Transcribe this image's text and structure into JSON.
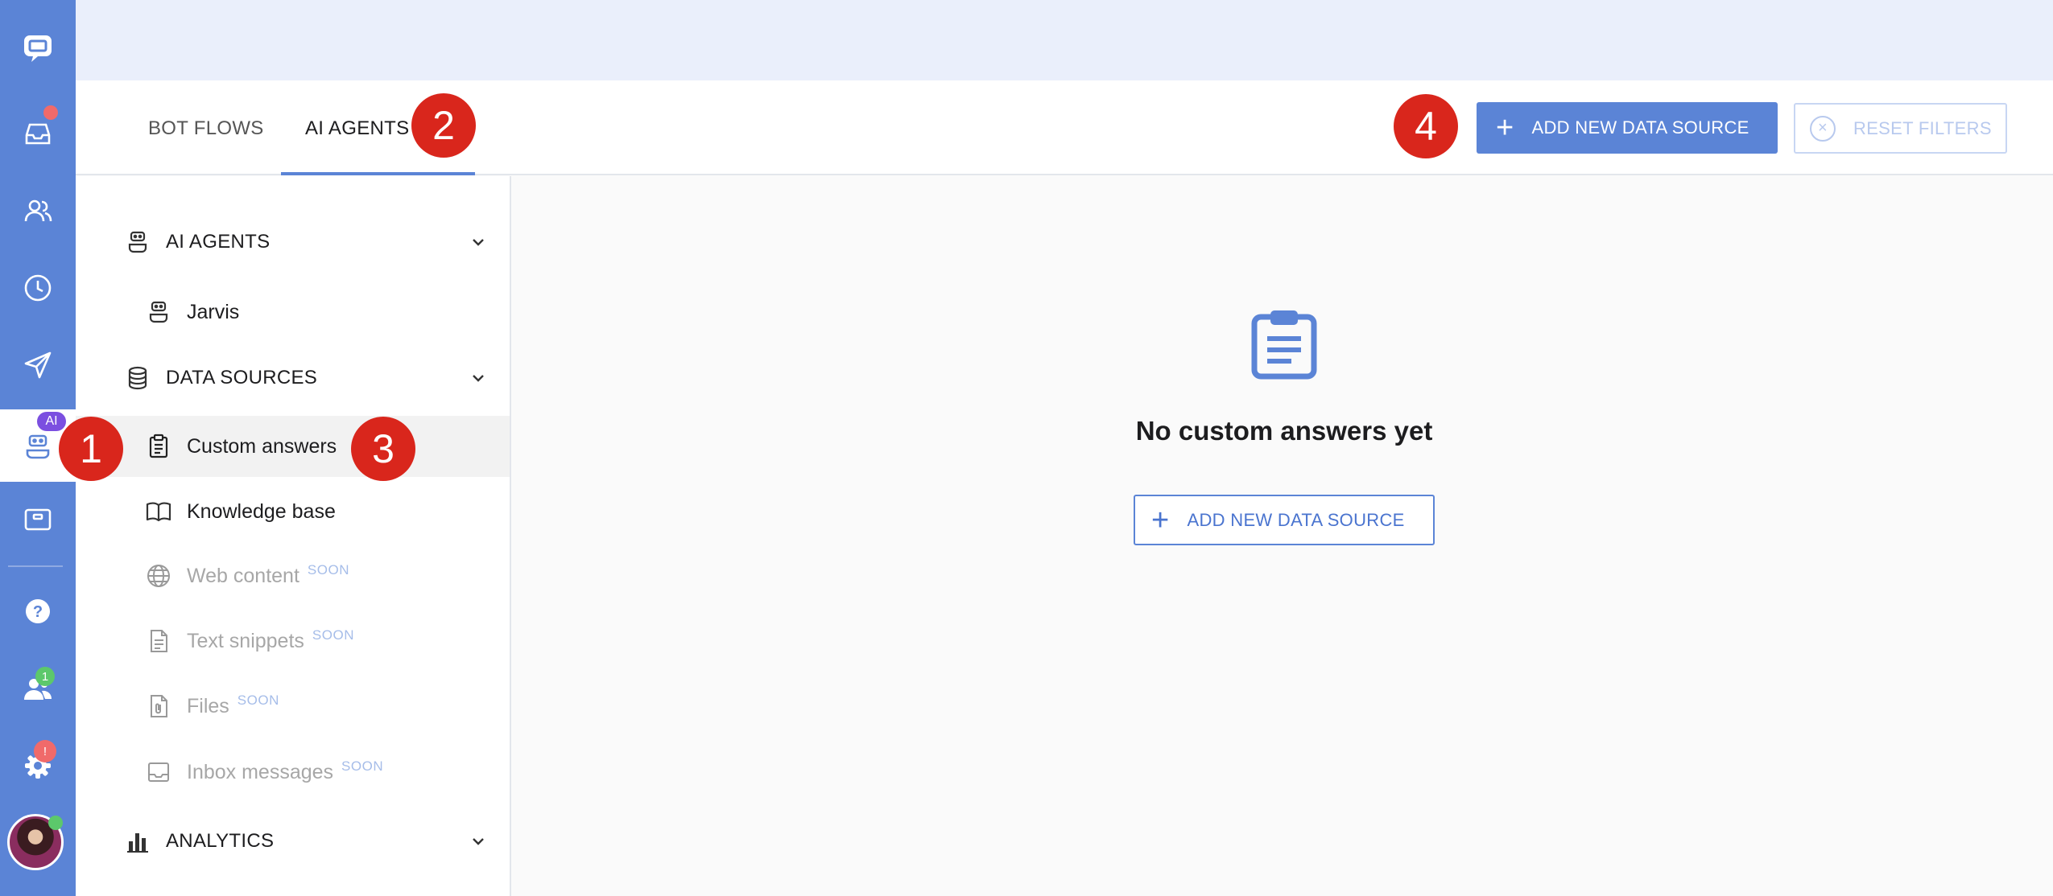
{
  "nav_rail": {
    "ai_badge": "AI",
    "team_count": "1",
    "settings_alert": "!"
  },
  "header": {
    "tabs": [
      {
        "label": "BOT FLOWS"
      },
      {
        "label": "AI AGENTS"
      }
    ],
    "add_data_source_label": "ADD NEW DATA SOURCE",
    "reset_filters_label": "RESET FILTERS"
  },
  "sidebar": {
    "sections": [
      {
        "label": "AI AGENTS",
        "icon": "robot-icon"
      },
      {
        "label": "DATA SOURCES",
        "icon": "database-icon"
      },
      {
        "label": "ANALYTICS",
        "icon": "bar-chart-icon"
      }
    ],
    "agents": [
      {
        "label": "Jarvis",
        "icon": "robot-icon"
      }
    ],
    "data_sources": [
      {
        "label": "Custom answers",
        "icon": "clipboard-icon",
        "soon": ""
      },
      {
        "label": "Knowledge base",
        "icon": "book-icon",
        "soon": ""
      },
      {
        "label": "Web content",
        "icon": "globe-icon",
        "soon": "SOON"
      },
      {
        "label": "Text snippets",
        "icon": "document-icon",
        "soon": "SOON"
      },
      {
        "label": "Files",
        "icon": "file-clip-icon",
        "soon": "SOON"
      },
      {
        "label": "Inbox messages",
        "icon": "inbox-icon",
        "soon": "SOON"
      }
    ]
  },
  "main": {
    "empty_title": "No custom answers yet",
    "add_button_label": "ADD NEW DATA SOURCE"
  },
  "annotations": [
    "1",
    "2",
    "3",
    "4"
  ],
  "colors": {
    "accent": "#5b84d6",
    "step_marker": "#d9261c",
    "soon": "#a6bde9"
  }
}
